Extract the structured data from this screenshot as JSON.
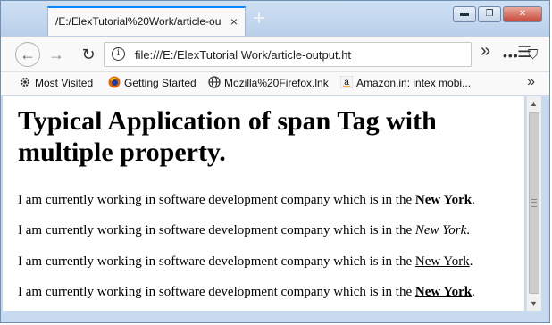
{
  "window": {
    "tab_title": "/E:/ElexTutorial%20Work/article-ou",
    "tab_close": "×",
    "new_tab": "+",
    "controls": {
      "minimize": "▬",
      "maximize": "❐",
      "close": "✕"
    }
  },
  "toolbar": {
    "back": "←",
    "forward": "→",
    "reload": "↻",
    "url": "file:///E:/ElexTutorial Work/article-output.ht",
    "page_actions": "•••",
    "pocket": "⛉",
    "star": "☆",
    "overflow": "»",
    "menu": "☰"
  },
  "bookmarks": [
    {
      "label": "Most Visited",
      "icon": "gear-icon"
    },
    {
      "label": "Getting Started",
      "icon": "firefox-icon"
    },
    {
      "label": "Mozilla%20Firefox.lnk",
      "icon": "globe-icon"
    },
    {
      "label": "Amazon.in: intex mobi...",
      "icon": "amazon-icon"
    }
  ],
  "bookmarks_more": "»",
  "page": {
    "heading": "Typical Application of span Tag with multiple property.",
    "paragraph_prefix": "I am currently working in software development company which is in the ",
    "span_text": "New York",
    "paragraph_suffix": "."
  },
  "colors": {
    "accent": "#0a84ff",
    "titlebar": "#c8daf0",
    "close_button": "#c8483a"
  }
}
